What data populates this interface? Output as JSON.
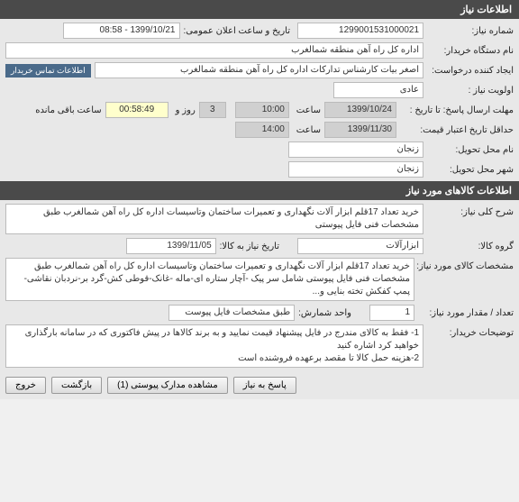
{
  "sections": {
    "need_info_header": "اطلاعات نیاز",
    "goods_info_header": "اطلاعات کالاهای مورد نیاز"
  },
  "labels": {
    "need_number": "شماره نیاز:",
    "public_announce_datetime": "تاریخ و ساعت اعلان عمومی:",
    "buyer_org": "نام دستگاه خریدار:",
    "request_creator": "ایجاد کننده درخواست:",
    "need_priority": "اولویت نیاز :",
    "response_deadline": "مهلت ارسال پاسخ:  تا تاریخ :",
    "time": "ساعت",
    "days_and": "روز و",
    "remaining": "ساعت باقی مانده",
    "min_price_validity": "حداقل تاریخ اعتبار قیمت:",
    "delivery_place": "نام محل تحویل:",
    "delivery_city": "شهر محل تحویل:",
    "contact_info_btn": "اطلاعات تماس خریدار",
    "need_desc": "شرح کلی نیاز:",
    "goods_group": "گروه کالا:",
    "need_date_to": "تاریخ نیاز به کالا:",
    "goods_spec": "مشخصات کالای مورد نیاز:",
    "qty": "تعداد / مقدار مورد نیاز:",
    "count_unit": "واحد شمارش:",
    "attached_spec": "طبق مشخصات فایل پیوست",
    "buyer_notes": "توضیحات خریدار:"
  },
  "values": {
    "need_number": "1299001531000021",
    "public_announce_datetime": "1399/10/21 - 08:58",
    "buyer_org": "اداره کل راه آهن منطقه شمالغرب",
    "request_creator": "اصغر بیات کارشناس تدارکات اداره کل راه آهن منطقه شمالغرب",
    "need_priority": "عادی",
    "response_deadline_date": "1399/10/24",
    "response_deadline_time": "10:00",
    "remaining_days": "3",
    "remaining_time": "00:58:49",
    "min_price_validity_date": "1399/11/30",
    "min_price_validity_time": "14:00",
    "delivery_place": "زنجان",
    "delivery_city": "زنجان",
    "need_desc": "خرید تعداد 17قلم ابزار آلات نگهداری و تعمیرات ساختمان وتاسیسات اداره کل راه آهن شمالغرب طبق مشخصات فنی فایل پیوستی",
    "goods_group": "ابزارآلات",
    "need_date_to": "1399/11/05",
    "goods_spec": "خرید تعداد 17قلم ابزار آلات نگهداری و تعمیرات ساختمان وتاسیسات اداره کل راه آهن شمالغرب طبق مشخصات فنی فایل پیوستی شامل سر پیک -آچار ستاره ای-ماله -غانک-قوطی کش-گرد بر-نردبان نقاشی-پمپ کفکش تخته بنایی و...",
    "qty": "1",
    "buyer_notes": "1- فقط به کالای مندرج در فایل پیشنهاد قیمت نمایید و به برند کالاها در پیش فاکتوری که در سامانه بارگذاری خواهید کرد اشاره کنید\n2-هزینه حمل کالا تا مقصد برعهده فروشنده است"
  },
  "buttons": {
    "reply": "پاسخ به نیاز",
    "view_attachments": "مشاهده مدارک پیوستی (1)",
    "back": "بازگشت",
    "exit": "خروج"
  }
}
